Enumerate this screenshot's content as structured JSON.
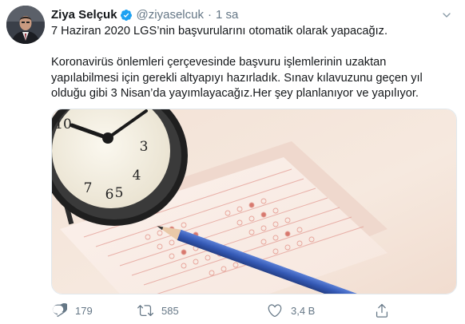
{
  "author": {
    "name": "Ziya Selçuk",
    "handle": "@ziyaselcuk",
    "separator": "·",
    "time": "1 sa",
    "verified": true
  },
  "tweet": {
    "line1": "7 Haziran 2020 LGS’nin başvurularını otomatik olarak yapacağız.",
    "line2": "Koronavirüs önlemleri çerçevesinde başvuru işlemlerinin uzaktan",
    "line3": "yapılabilmesi için gerekli altyapıyı hazırladık. Sınav kılavuzunu geçen yıl",
    "line4": "olduğu gibi 3 Nisan’da yayımlayacağız.Her şey planlanıyor ve yapılıyor."
  },
  "actions": {
    "reply_count": "179",
    "retweet_count": "585",
    "like_count": "3,4 B"
  },
  "icons": {
    "verified": "verified-badge-icon",
    "caret": "chevron-down-icon",
    "reply": "reply-icon",
    "retweet": "retweet-icon",
    "like": "heart-icon",
    "share": "share-icon"
  },
  "colors": {
    "text": "#14171a",
    "secondary": "#657786",
    "verified_blue": "#1da1f2"
  }
}
